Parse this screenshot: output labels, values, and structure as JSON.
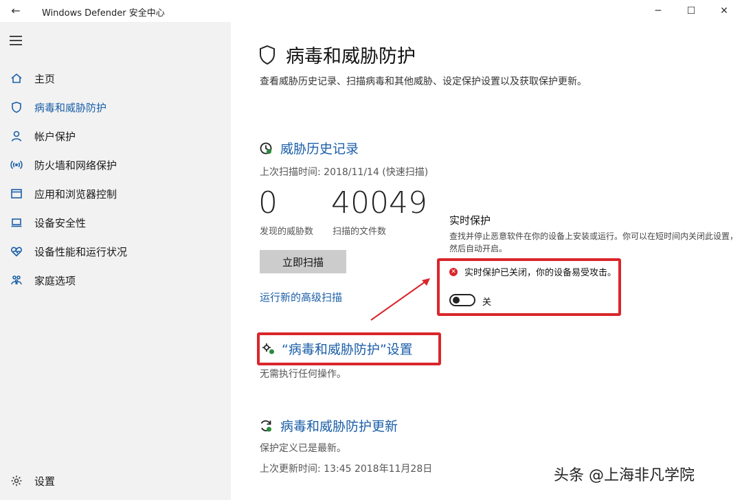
{
  "window": {
    "title": "Windows Defender 安全中心",
    "back_glyph": "←",
    "minimize_glyph": "─",
    "maximize_glyph": "☐",
    "close_glyph": "✕"
  },
  "sidebar": {
    "items": [
      {
        "label": "主页",
        "icon": "home-icon"
      },
      {
        "label": "病毒和威胁防护",
        "icon": "shield-icon"
      },
      {
        "label": "帐户保护",
        "icon": "person-icon"
      },
      {
        "label": "防火墙和网络保护",
        "icon": "wireless-icon"
      },
      {
        "label": "应用和浏览器控制",
        "icon": "app-window-icon"
      },
      {
        "label": "设备安全性",
        "icon": "laptop-icon"
      },
      {
        "label": "设备性能和运行状况",
        "icon": "heart-icon"
      },
      {
        "label": "家庭选项",
        "icon": "family-icon"
      }
    ],
    "settings_label": "设置"
  },
  "main": {
    "title": "病毒和威胁防护",
    "description": "查看威胁历史记录、扫描病毒和其他威胁、设定保护设置以及获取保护更新。",
    "threat_history": {
      "heading": "威胁历史记录",
      "last_scan": "上次扫描时间: 2018/11/14 (快速扫描)",
      "threats_found": "0",
      "threats_found_label": "发现的威胁数",
      "files_scanned": "40049",
      "files_scanned_label": "扫描的文件数",
      "scan_button": "立即扫描",
      "advanced_scan_link": "运行新的高级扫描"
    },
    "settings": {
      "heading": "“病毒和威胁防护”设置",
      "status": "无需执行任何操作。"
    },
    "updates": {
      "heading": "病毒和威胁防护更新",
      "status": "保护定义已是最新。",
      "last_update": "上次更新时间: 13:45 2018年11月28日"
    }
  },
  "realtime": {
    "title": "实时保护",
    "description": "查找并停止恶意软件在你的设备上安装或运行。你可以在短时间内关闭此设置，然后自动开启。",
    "warning": "实时保护已关闭，你的设备易受攻击。",
    "toggle_state": "关",
    "toggle_on": false
  },
  "watermark": "头条 @上海非凡学院",
  "colors": {
    "accent": "#1b5fa8",
    "highlight": "#d9262a",
    "sidebar_bg": "#f2f2f2"
  }
}
